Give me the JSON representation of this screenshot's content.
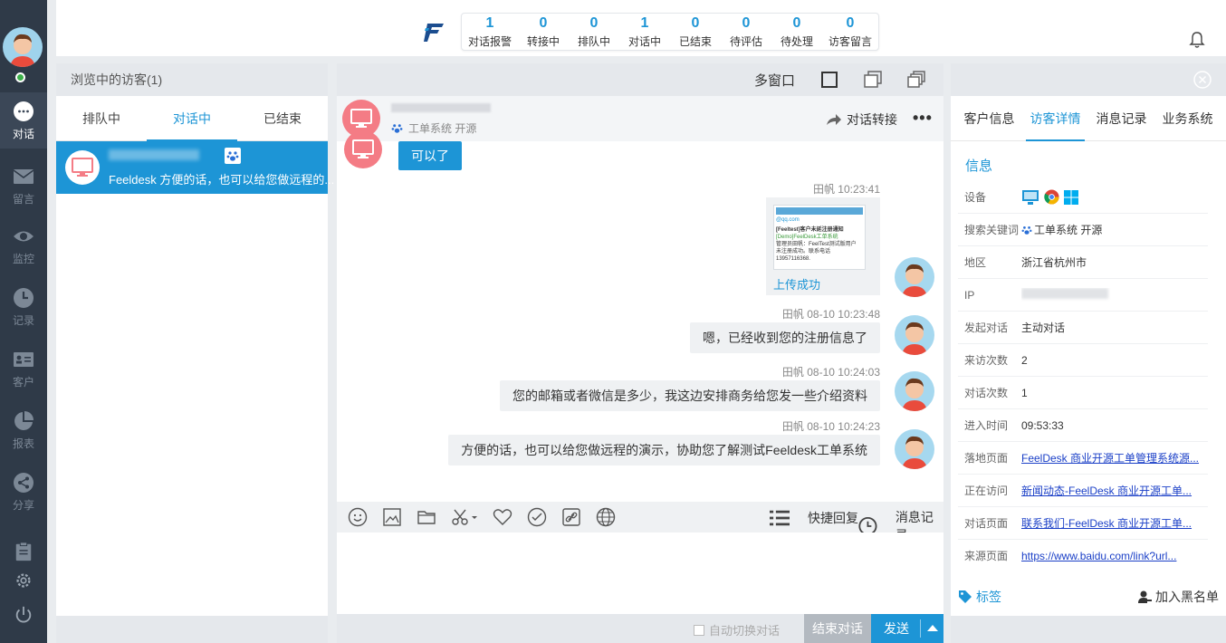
{
  "nav": {
    "items": [
      {
        "label": "对话",
        "icon": "chat-icon"
      },
      {
        "label": "留言",
        "icon": "mail-icon"
      },
      {
        "label": "监控",
        "icon": "eye-icon"
      },
      {
        "label": "记录",
        "icon": "clock-icon"
      },
      {
        "label": "客户",
        "icon": "contact-card-icon"
      },
      {
        "label": "报表",
        "icon": "pie-chart-icon"
      },
      {
        "label": "分享",
        "icon": "share-icon"
      }
    ]
  },
  "stats": [
    {
      "value": "1",
      "label": "对话报警"
    },
    {
      "value": "0",
      "label": "转接中"
    },
    {
      "value": "0",
      "label": "排队中"
    },
    {
      "value": "1",
      "label": "对话中"
    },
    {
      "value": "0",
      "label": "已结束"
    },
    {
      "value": "0",
      "label": "待评估"
    },
    {
      "value": "0",
      "label": "待处理"
    },
    {
      "value": "0",
      "label": "访客留言"
    }
  ],
  "visitors": {
    "header": "浏览中的访客(1)",
    "tabs": [
      "排队中",
      "对话中",
      "已结束"
    ],
    "active_tab": 1,
    "item": {
      "preview": "Feeldesk 方便的话，也可以给您做远程的..."
    }
  },
  "chat": {
    "toolbar": {
      "multi": "多窗口"
    },
    "header": {
      "keyword": "工单系统 开源",
      "transfer": "对话转接"
    },
    "visitor_msg": "可以了",
    "upload": {
      "meta": "田帆  10:23:41",
      "status": "上传成功",
      "thumb_title": "[Feeltest]客户未延注册通知",
      "thumb_sub": "[Demo]FeelDesk工单系统",
      "thumb_mail": "@qq.com",
      "thumb_body": "管理员田帆：FeelTest测试版用户 未注册成功。联系电话13957116368."
    },
    "messages": [
      {
        "meta": "田帆  08-10 10:23:48",
        "text": "嗯，已经收到您的注册信息了"
      },
      {
        "meta": "田帆  08-10 10:24:03",
        "text": "您的邮箱或者微信是多少，我这边安排商务给您发一些介绍资料"
      },
      {
        "meta": "田帆  08-10 10:24:23",
        "text": "方便的话，也可以给您做远程的演示，协助您了解测试Feeldesk工单系统"
      }
    ],
    "tools": {
      "quick_reply": "快捷回复",
      "history": "消息记录"
    },
    "footer": {
      "auto_switch": "自动切换对话",
      "end": "结束对话",
      "send": "发送"
    }
  },
  "detail": {
    "tabs": [
      "客户信息",
      "访客详情",
      "消息记录",
      "业务系统"
    ],
    "active_tab": 1,
    "section": "信息",
    "rows": [
      {
        "key": "设备",
        "value": ""
      },
      {
        "key": "搜索关键词",
        "value": "工单系统 开源"
      },
      {
        "key": "地区",
        "value": "浙江省杭州市"
      },
      {
        "key": "IP",
        "value": ""
      },
      {
        "key": "发起对话",
        "value": "主动对话"
      },
      {
        "key": "来访次数",
        "value": "2"
      },
      {
        "key": "对话次数",
        "value": "1"
      },
      {
        "key": "进入时间",
        "value": "09:53:33"
      },
      {
        "key": "落地页面",
        "value": "FeelDesk 商业开源工单管理系统源..."
      },
      {
        "key": "正在访问",
        "value": "新闻动态-FeelDesk 商业开源工单..."
      },
      {
        "key": "对话页面",
        "value": "联系我们-FeelDesk 商业开源工单..."
      },
      {
        "key": "来源页面",
        "value": "https://www.baidu.com/link?url..."
      }
    ],
    "footer": {
      "tag": "标签",
      "blacklist": "加入黑名单"
    }
  },
  "colors": {
    "accent": "#1d95d6",
    "rail": "#2f3a48",
    "visitor_avatar": "#f47c85",
    "link": "#1a3fc7"
  }
}
